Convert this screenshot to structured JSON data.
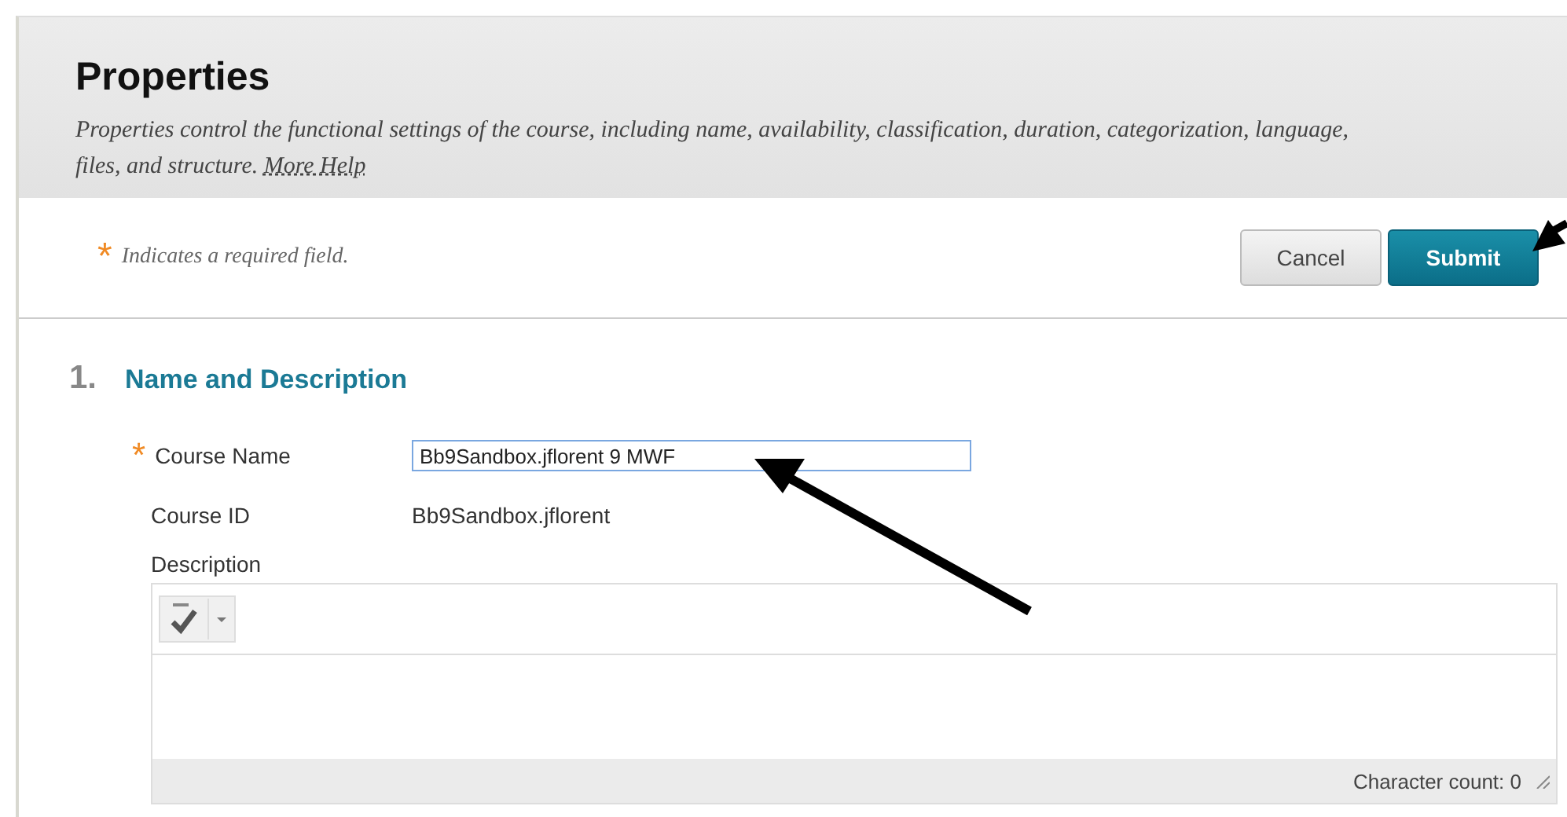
{
  "header": {
    "title": "Properties",
    "description": "Properties control the functional settings of the course, including name, availability, classification, duration, categorization, language, files, and structure.",
    "help_link": "More Help"
  },
  "required_note": {
    "marker": "*",
    "text": "Indicates a required field."
  },
  "buttons": [
    {
      "label": "Cancel",
      "kind": "secondary"
    },
    {
      "label": "Submit",
      "kind": "primary"
    }
  ],
  "section": {
    "number": "1.",
    "title": "Name and Description"
  },
  "fields": [
    {
      "label": "Course Name",
      "required": true,
      "kind": "input",
      "value": "Bb9Sandbox.jflorent 9 MWF"
    },
    {
      "label": "Course ID",
      "required": false,
      "kind": "text",
      "value": "Bb9Sandbox.jflorent"
    }
  ],
  "description": {
    "label": "Description",
    "character_count": "Character count: 0"
  }
}
